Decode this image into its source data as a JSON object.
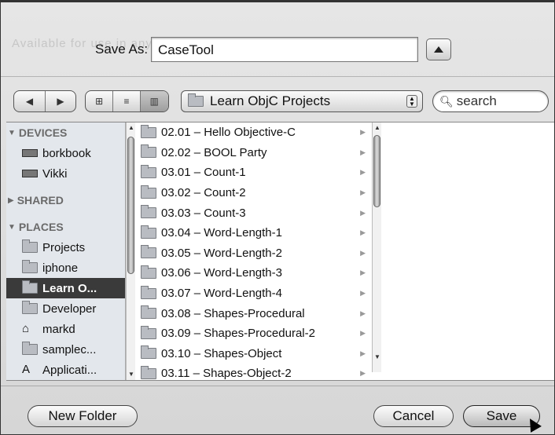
{
  "dialog": {
    "ghost_text": "Available for use in any project",
    "save_as_label": "Save As:",
    "save_as_value": "CaseTool"
  },
  "toolbar": {
    "back_glyph": "◀",
    "forward_glyph": "▶",
    "view_icon_glyph": "⊞",
    "view_list_glyph": "≡",
    "view_column_glyph": "▥",
    "location": "Learn ObjC Projects",
    "search_placeholder": "search"
  },
  "sidebar": {
    "sections": [
      {
        "title": "DEVICES",
        "expanded": true,
        "items": [
          {
            "label": "borkbook",
            "icon": "laptop-icon"
          },
          {
            "label": "Vikki",
            "icon": "drive-icon"
          }
        ]
      },
      {
        "title": "SHARED",
        "expanded": false,
        "items": []
      },
      {
        "title": "PLACES",
        "expanded": true,
        "items": [
          {
            "label": "Projects",
            "icon": "folder-icon"
          },
          {
            "label": "iphone",
            "icon": "folder-icon"
          },
          {
            "label": "Learn O...",
            "icon": "folder-icon",
            "selected": true
          },
          {
            "label": "Developer",
            "icon": "folder-icon"
          },
          {
            "label": "markd",
            "icon": "house-icon"
          },
          {
            "label": "samplec...",
            "icon": "folder-icon"
          },
          {
            "label": "Applicati...",
            "icon": "applications-icon"
          }
        ]
      }
    ]
  },
  "files": [
    "02.01 – Hello Objective-C",
    "02.02 – BOOL Party",
    "03.01 – Count-1",
    "03.02 – Count-2",
    "03.03 – Count-3",
    "03.04 – Word-Length-1",
    "03.05 – Word-Length-2",
    "03.06 – Word-Length-3",
    "03.07 – Word-Length-4",
    "03.08 – Shapes-Procedural",
    "03.09 – Shapes-Procedural-2",
    "03.10 – Shapes-Object",
    "03.11 – Shapes-Object-2"
  ],
  "buttons": {
    "new_folder": "New Folder",
    "cancel": "Cancel",
    "save": "Save"
  }
}
